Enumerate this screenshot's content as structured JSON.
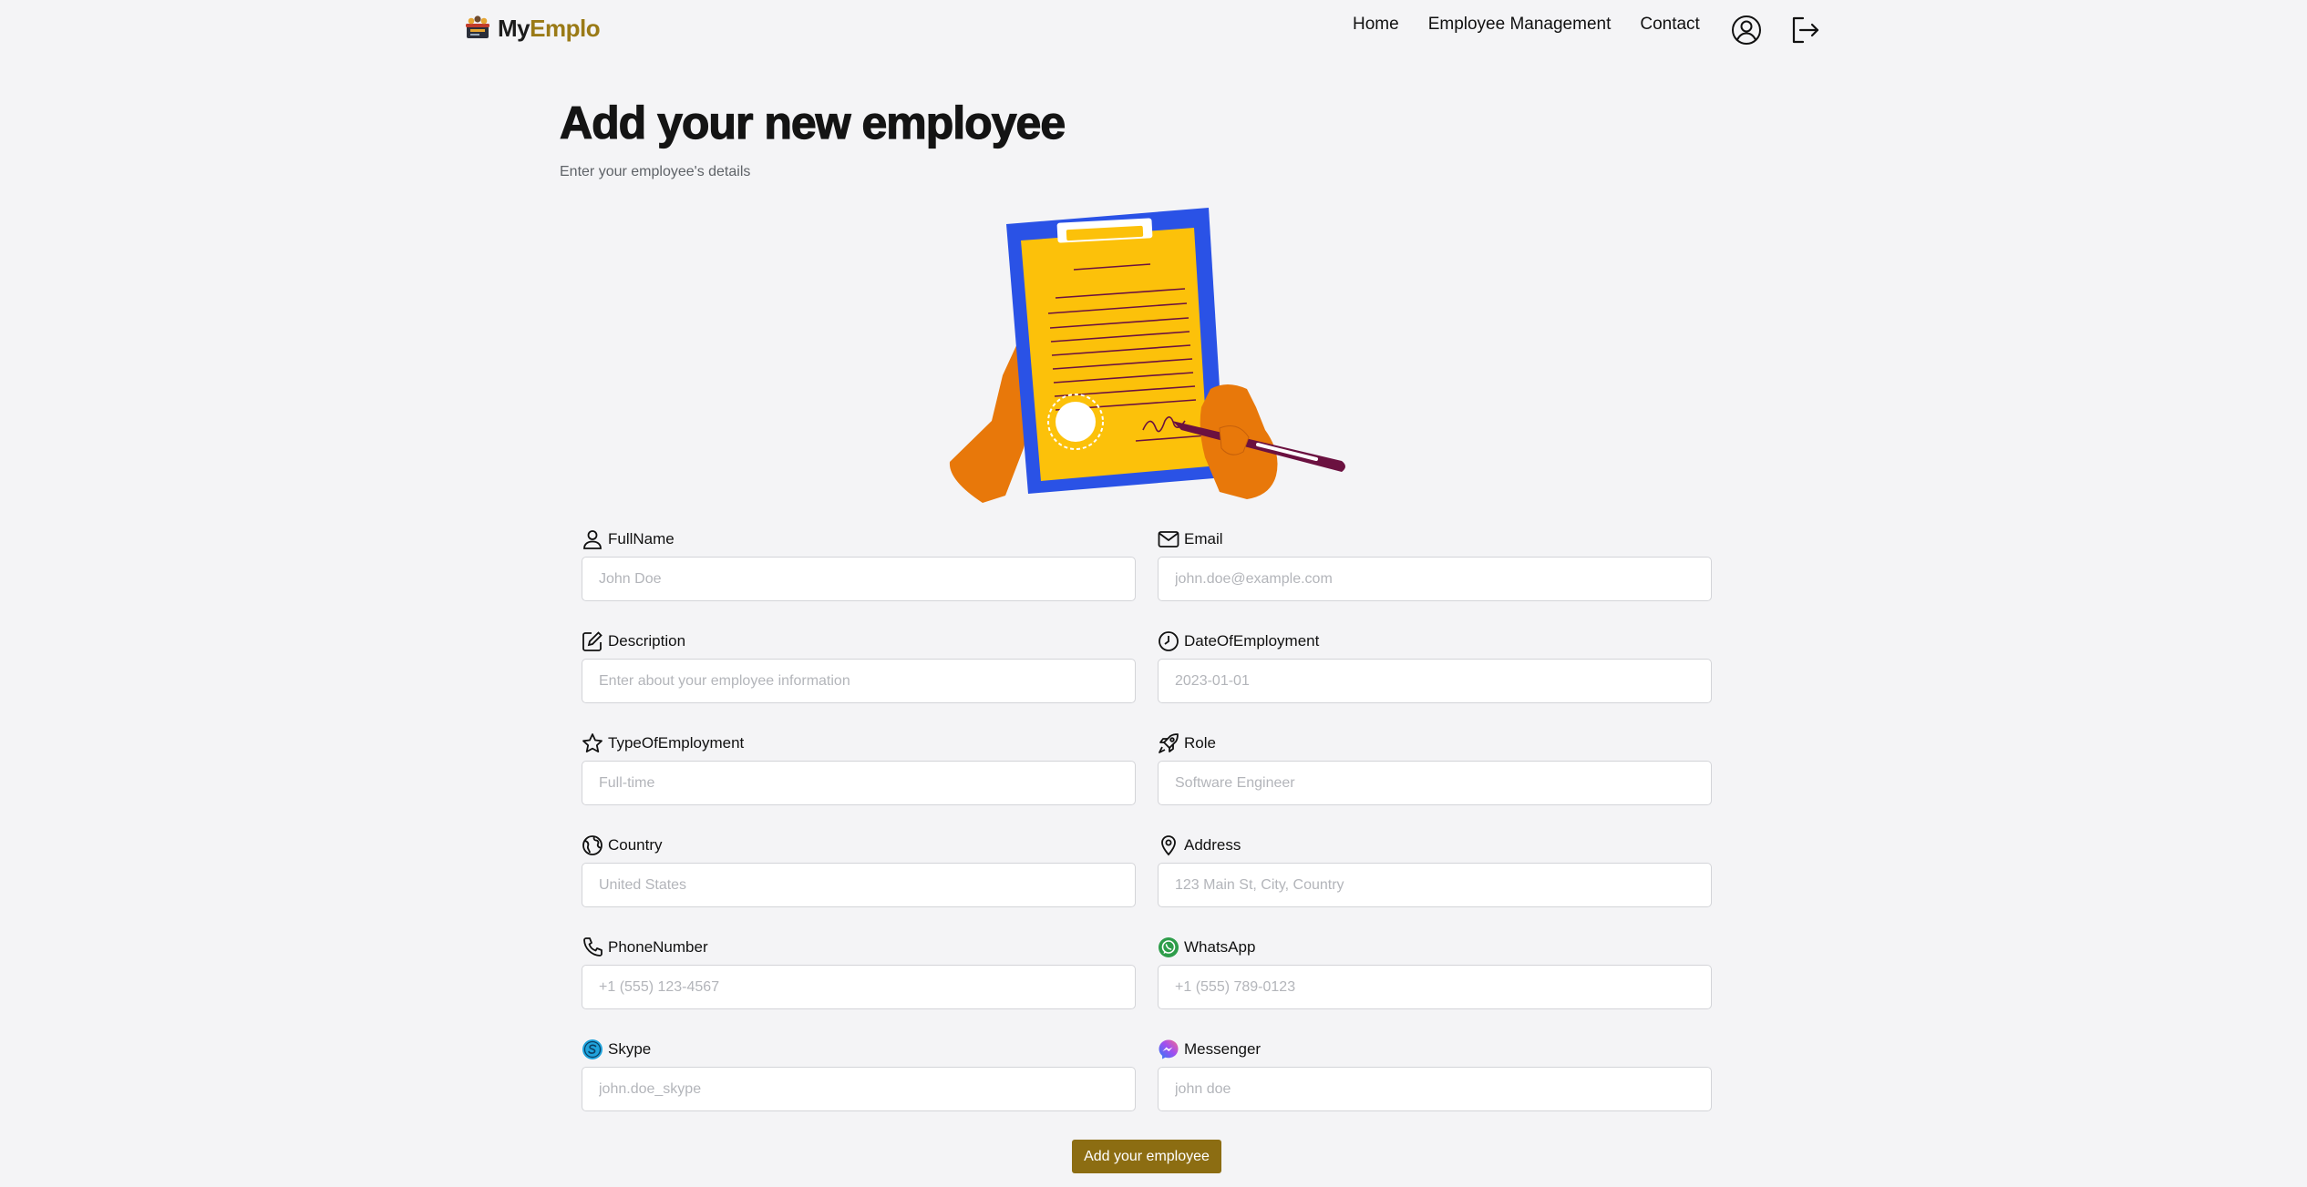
{
  "brand": {
    "part1": "My",
    "part2": "Emplo",
    "logo_icon": "team-logo-icon"
  },
  "nav": {
    "links": [
      "Home",
      "Employee Management",
      "Contact"
    ],
    "user_icon": "user-circle-icon",
    "logout_icon": "logout-icon"
  },
  "header": {
    "title": "Add your new employee",
    "subtitle": "Enter your employee's details",
    "illustration": "clipboard-signing-illustration"
  },
  "form": {
    "fields": [
      {
        "label": "FullName",
        "placeholder": "John Doe",
        "icon": "person-icon"
      },
      {
        "label": "Email",
        "placeholder": "john.doe@example.com",
        "icon": "envelope-icon"
      },
      {
        "label": "Description",
        "placeholder": "Enter about your employee information",
        "icon": "pencil-square-icon"
      },
      {
        "label": "DateOfEmployment",
        "placeholder": "2023-01-01",
        "icon": "clock-icon"
      },
      {
        "label": "TypeOfEmployment",
        "placeholder": "Full-time",
        "icon": "star-icon"
      },
      {
        "label": "Role",
        "placeholder": "Software Engineer",
        "icon": "rocket-icon"
      },
      {
        "label": "Country",
        "placeholder": "United States",
        "icon": "globe-icon"
      },
      {
        "label": "Address",
        "placeholder": "123 Main St, City, Country",
        "icon": "map-pin-icon"
      },
      {
        "label": "PhoneNumber",
        "placeholder": "+1 (555) 123-4567",
        "icon": "phone-icon"
      },
      {
        "label": "WhatsApp",
        "placeholder": "+1 (555) 789-0123",
        "icon": "whatsapp-icon"
      },
      {
        "label": "Skype",
        "placeholder": "john.doe_skype",
        "icon": "skype-icon"
      },
      {
        "label": "Messenger",
        "placeholder": "john doe",
        "icon": "messenger-icon"
      }
    ],
    "submit_label": "Add your employee"
  },
  "colors": {
    "background": "#f4f4f6",
    "brand_accent": "#9a7a16",
    "button": "#8c6d12",
    "input_border": "#d3d4d8"
  }
}
